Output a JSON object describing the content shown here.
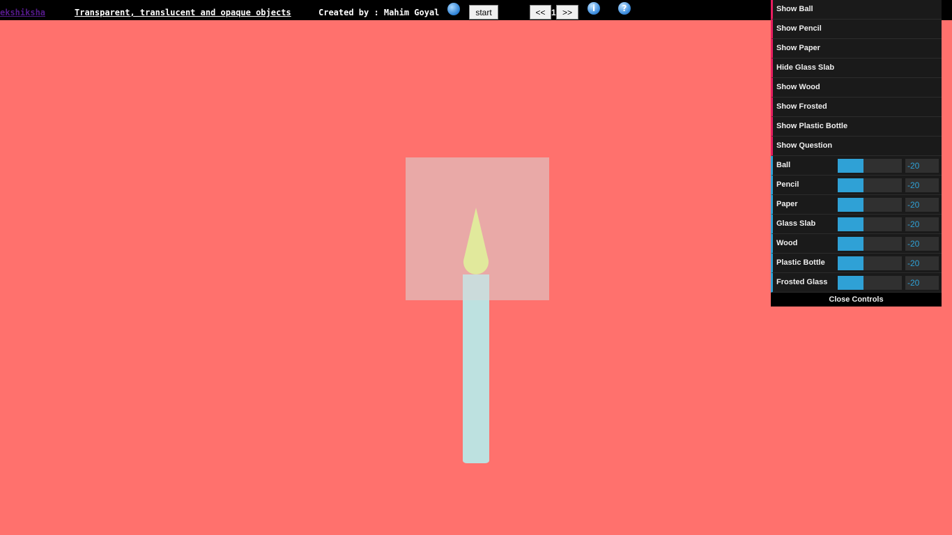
{
  "topbar": {
    "brand": "ekshiksha",
    "title": "Transparent, translucent and opaque objects",
    "credit": "Created by : Mahim Goyal",
    "start_label": "start",
    "prev_label": "<<",
    "page_number": "1",
    "next_label": ">>",
    "info_symbol": "i",
    "help_symbol": "?"
  },
  "panel": {
    "buttons": [
      {
        "label": "Show Ball"
      },
      {
        "label": "Show Pencil"
      },
      {
        "label": "Show Paper"
      },
      {
        "label": "Hide Glass Slab"
      },
      {
        "label": "Show Wood"
      },
      {
        "label": "Show Frosted"
      },
      {
        "label": "Show Plastic Bottle"
      },
      {
        "label": "Show Question"
      }
    ],
    "sliders": [
      {
        "label": "Ball",
        "value": "-20",
        "fill_fraction": 0.4
      },
      {
        "label": "Pencil",
        "value": "-20",
        "fill_fraction": 0.4
      },
      {
        "label": "Paper",
        "value": "-20",
        "fill_fraction": 0.4
      },
      {
        "label": "Glass Slab",
        "value": "-20",
        "fill_fraction": 0.4
      },
      {
        "label": "Wood",
        "value": "-20",
        "fill_fraction": 0.4
      },
      {
        "label": "Plastic Bottle",
        "value": "-20",
        "fill_fraction": 0.4
      },
      {
        "label": "Frosted Glass",
        "value": "-20",
        "fill_fraction": 0.4
      }
    ],
    "close_label": "Close Controls"
  },
  "colors": {
    "background": "#ff716d",
    "accent": "#2fa1d6",
    "flame": "#eefe55",
    "candle": "#b2f5f5"
  }
}
